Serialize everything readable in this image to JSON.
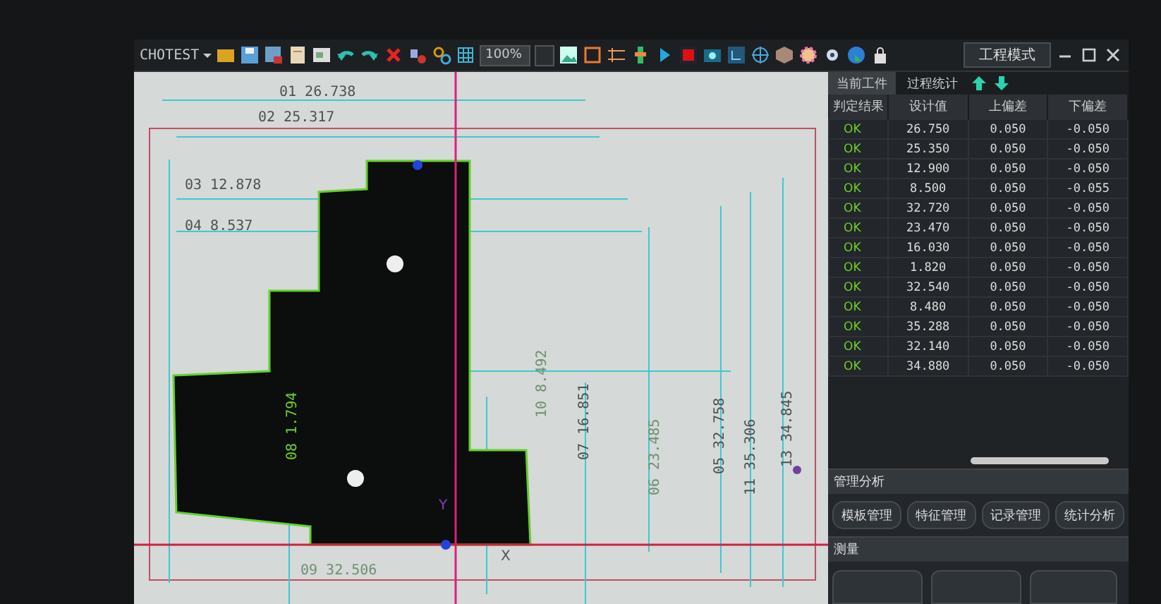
{
  "toolbar": {
    "title": "CHOTEST",
    "zoom": "100%",
    "mode_button": "工程模式"
  },
  "canvas": {
    "labels": [
      {
        "text": "01 26.738",
        "kind": "horizontal",
        "color": "#4a5350"
      },
      {
        "text": "02 25.317",
        "kind": "horizontal",
        "color": "#4a5350"
      },
      {
        "text": "03 12.878",
        "kind": "horizontal",
        "color": "#4a5350"
      },
      {
        "text": "04 8.537",
        "kind": "horizontal",
        "color": "#4a5350"
      },
      {
        "text": "08 1.794",
        "kind": "vertical",
        "color": "#6fd12a"
      },
      {
        "text": "10 8.492",
        "kind": "vertical",
        "color": "#6f8f70"
      },
      {
        "text": "07 16.851",
        "kind": "vertical",
        "color": "#4a5350"
      },
      {
        "text": "06 23.485",
        "kind": "vertical",
        "color": "#6f8f70"
      },
      {
        "text": "05 32.758",
        "kind": "vertical",
        "color": "#4a5350"
      },
      {
        "text": "11 35.306",
        "kind": "vertical",
        "color": "#4a5350"
      },
      {
        "text": "13 34.845",
        "kind": "vertical",
        "color": "#4a5350"
      },
      {
        "text": "09 32.506",
        "kind": "horizontal",
        "color": "#6f8f70"
      }
    ],
    "axis_labels": [
      "Y",
      "X"
    ]
  },
  "panel": {
    "tabs": [
      {
        "label": "当前工件",
        "selected": true
      },
      {
        "label": "过程统计",
        "selected": false
      }
    ],
    "table": {
      "columns": [
        "判定结果",
        "设计值",
        "上偏差",
        "下偏差"
      ],
      "rows": [
        [
          "OK",
          "26.750",
          "0.050",
          "-0.050"
        ],
        [
          "OK",
          "25.350",
          "0.050",
          "-0.050"
        ],
        [
          "OK",
          "12.900",
          "0.050",
          "-0.050"
        ],
        [
          "OK",
          "8.500",
          "0.050",
          "-0.055"
        ],
        [
          "OK",
          "32.720",
          "0.050",
          "-0.050"
        ],
        [
          "OK",
          "23.470",
          "0.050",
          "-0.050"
        ],
        [
          "OK",
          "16.030",
          "0.050",
          "-0.050"
        ],
        [
          "OK",
          "1.820",
          "0.050",
          "-0.050"
        ],
        [
          "OK",
          "32.540",
          "0.050",
          "-0.050"
        ],
        [
          "OK",
          "8.480",
          "0.050",
          "-0.050"
        ],
        [
          "OK",
          "35.288",
          "0.050",
          "-0.050"
        ],
        [
          "OK",
          "32.140",
          "0.050",
          "-0.050"
        ],
        [
          "OK",
          "34.880",
          "0.050",
          "-0.050"
        ]
      ]
    },
    "sections": [
      {
        "title": "管理分析",
        "buttons": [
          "模板管理",
          "特征管理",
          "记录管理",
          "统计分析"
        ]
      },
      {
        "title": "测量"
      }
    ]
  }
}
